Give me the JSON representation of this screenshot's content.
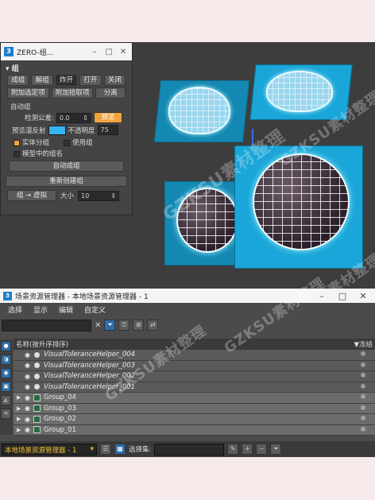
{
  "group_dialog": {
    "title": "ZERO-组...",
    "section": "组",
    "buttons_row1": [
      "成组",
      "解组",
      "炸开",
      "打开",
      "关闭"
    ],
    "buttons_row2": [
      "附加选定项",
      "附加拾取项",
      "分离"
    ],
    "auto_group": {
      "label": "自动组",
      "tolerance_label": "检测公差:",
      "tolerance_value": "0.0",
      "preview_button": "预览",
      "preview_reflect_label": "预览漫反射",
      "opacity_label": "不透明度",
      "opacity_value": "75",
      "solid_group_label": "实体分组",
      "use_group_label": "使用组",
      "model_group_name_label": "模型中的组名",
      "auto_group_button": "自动成组"
    },
    "recreate_button": "重新创建组",
    "group_to_virtual_button": "组 → 虚拟",
    "size_label": "大小",
    "size_value": "10"
  },
  "scene_explorer": {
    "title": "场景资源管理器 - 本地场景资源管理器 - 1",
    "menu": [
      "选择",
      "显示",
      "编辑",
      "自定义"
    ],
    "column_name": "名称(按升序排序)",
    "column_freeze": "▼冻结",
    "helpers": [
      "VisualToleranceHelper_004",
      "VisualToleranceHelper_003",
      "VisualToleranceHelper_002",
      "VisualToleranceHelper_001"
    ],
    "groups": [
      "Group_04",
      "Group_03",
      "Group_02",
      "Group_01"
    ],
    "explorer_select": "本地场景资源管理器 - 1",
    "selection_set_label": "选择集:"
  },
  "watermark": "GZKSU素材整理",
  "colors": {
    "viewport_bg": "#3d3d3d",
    "box_blue": "#1aa6d8",
    "accent_orange": "#f2a23c",
    "selected_blue": "#2c6ea8"
  }
}
